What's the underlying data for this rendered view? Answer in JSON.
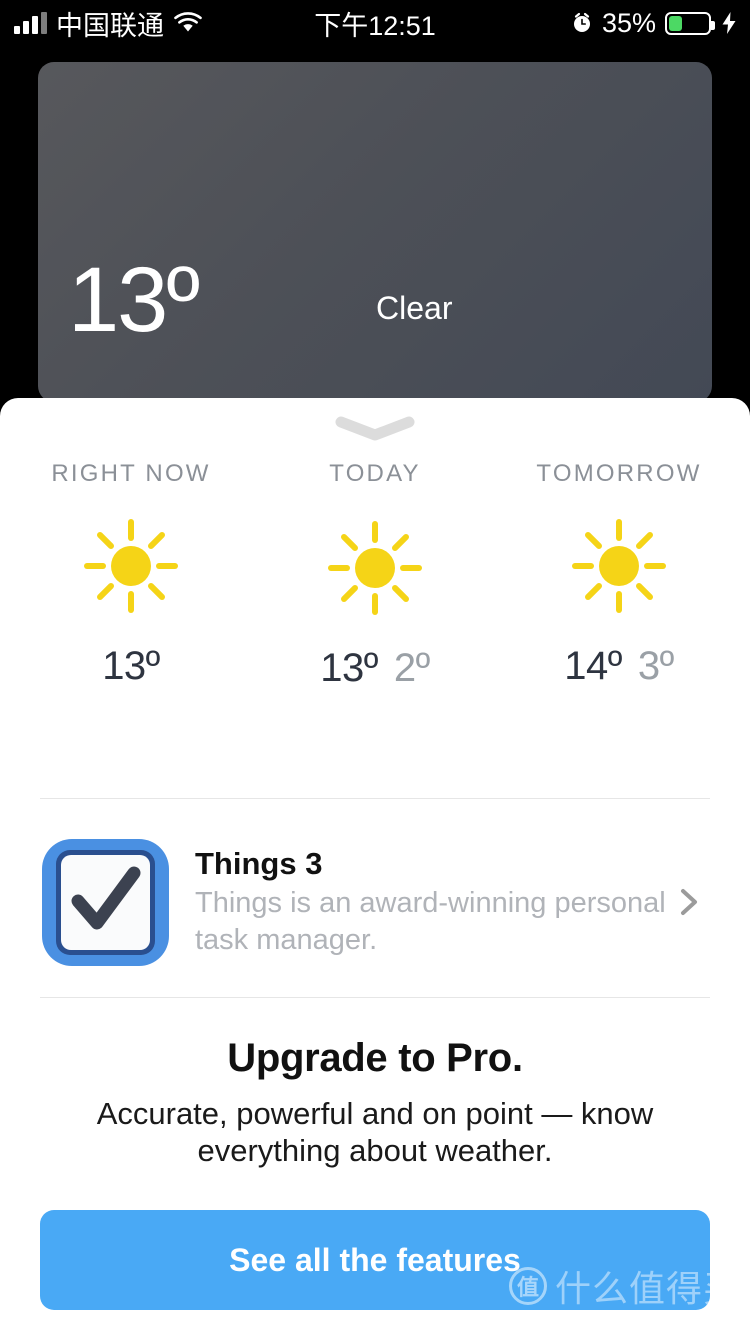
{
  "status_bar": {
    "carrier": "中国联通",
    "time": "下午12:51",
    "battery_percent": "35%",
    "battery_level": 35,
    "signal_icon": "cellular-signal-icon",
    "wifi_icon": "wifi-icon",
    "alarm_icon": "alarm-clock-icon",
    "battery_icon": "battery-icon",
    "charging_icon": "lightning-bolt-icon"
  },
  "hero": {
    "temperature": "13º",
    "condition": "Clear"
  },
  "sheet": {
    "grabber_icon": "chevron-down-grabber-icon"
  },
  "forecast": [
    {
      "label": "RIGHT NOW",
      "icon": "sun-icon",
      "high": "13º",
      "low": ""
    },
    {
      "label": "TODAY",
      "icon": "sun-icon",
      "high": "13º",
      "low": "2º"
    },
    {
      "label": "TOMORROW",
      "icon": "sun-icon",
      "high": "14º",
      "low": "3º"
    }
  ],
  "promo": {
    "app_icon": "things-3-checkbox-icon",
    "title": "Things 3",
    "subtitle": "Things is an award-winning personal task manager.",
    "chevron_icon": "chevron-right-icon"
  },
  "upsell": {
    "title": "Upgrade to Pro.",
    "subtitle": "Accurate, powerful and on point — know everything about weather.",
    "cta_label": "See all the features"
  },
  "watermark": {
    "logo_char": "值",
    "text": "什么值得买"
  },
  "colors": {
    "cta_blue": "#49a9f5",
    "sun_yellow": "#f5d417",
    "temp_high": "#2e3440",
    "temp_low": "#9aa0a6",
    "label_gray": "#8b9097",
    "battery_green": "#4cd964",
    "things_blue": "#4a90e2"
  }
}
